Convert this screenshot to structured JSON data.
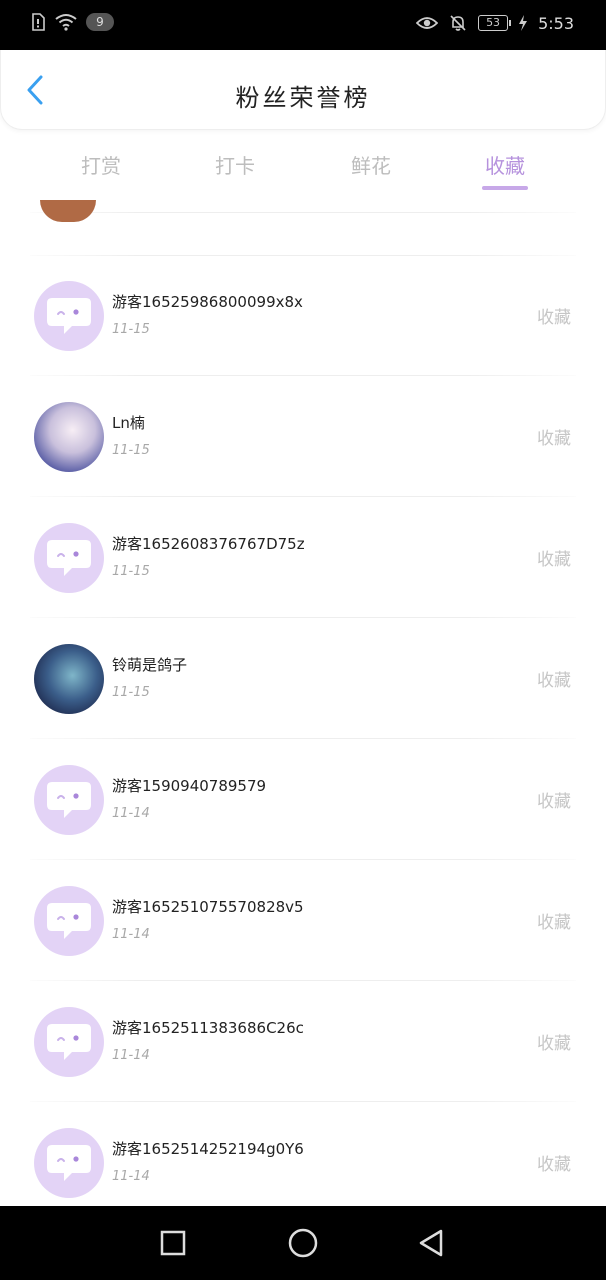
{
  "status_bar": {
    "notification_count": "9",
    "battery": "53",
    "time": "5:53",
    "icons": [
      "sim-icon",
      "wifi-icon",
      "eye-icon",
      "bell-off-icon",
      "charging-icon"
    ]
  },
  "header": {
    "title": "粉丝荣誉榜",
    "back_icon": "chevron-left-icon"
  },
  "tabs": [
    {
      "label": "打赏",
      "active": false
    },
    {
      "label": "打卡",
      "active": false
    },
    {
      "label": "鲜花",
      "active": false
    },
    {
      "label": "收藏",
      "active": true
    }
  ],
  "accent_color": "#b692dd",
  "list": [
    {
      "name": "游客16525986800099x8x",
      "date": "11-15",
      "action": "收藏",
      "avatar": "default"
    },
    {
      "name": "Ln楠",
      "date": "11-15",
      "action": "收藏",
      "avatar": "anime"
    },
    {
      "name": "游客1652608376767D75z",
      "date": "11-15",
      "action": "收藏",
      "avatar": "default"
    },
    {
      "name": "铃萌是鸽子",
      "date": "11-15",
      "action": "收藏",
      "avatar": "night"
    },
    {
      "name": "游客15909407895​79",
      "date": "11-14",
      "action": "收藏",
      "avatar": "default"
    },
    {
      "name": "游客165251075570828v5",
      "date": "11-14",
      "action": "收藏",
      "avatar": "default"
    },
    {
      "name": "游客1652511383686C26c",
      "date": "11-14",
      "action": "收藏",
      "avatar": "default"
    },
    {
      "name": "游客1652514252194g0Y6",
      "date": "11-14",
      "action": "收藏",
      "avatar": "default"
    }
  ],
  "nav_bar": {
    "buttons": [
      "recent-apps-icon",
      "home-icon",
      "back-icon"
    ]
  }
}
